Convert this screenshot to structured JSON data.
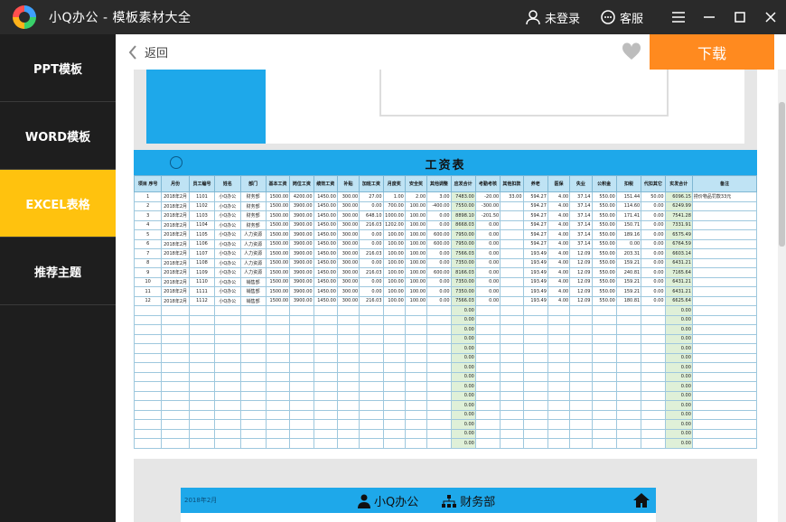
{
  "app": {
    "title": "小Q办公 - 模板素材大全"
  },
  "titlebar": {
    "login_label": "未登录",
    "service_label": "客服"
  },
  "sidebar": {
    "items": [
      {
        "label": "PPT模板",
        "active": false
      },
      {
        "label": "WORD模板",
        "active": false
      },
      {
        "label": "EXCEL表格",
        "active": true
      },
      {
        "label": "推荐主题",
        "active": false
      }
    ]
  },
  "toolbar": {
    "back_label": "返回",
    "download_label": "下载"
  },
  "sheet": {
    "title": "工资表",
    "headers": [
      "项目\n序号",
      "月份",
      "员工编号",
      "姓名",
      "部门",
      "基本工资",
      "岗位工资",
      "绩效工资",
      "补贴",
      "加班工资",
      "月度奖",
      "安全奖",
      "其他调整",
      "应发合计",
      "考勤考核",
      "其他扣款",
      "养老",
      "医保",
      "失业",
      "公积金",
      "扣税",
      "代扣其它",
      "实发合计",
      "备注"
    ],
    "rows": [
      [
        "1",
        "2018年2月",
        "1101",
        "小Q办公",
        "财务部",
        "1500.00",
        "4200.00",
        "1450.00",
        "300.00",
        "27.00",
        "1.00",
        "2.00",
        "3.00",
        "7483.00",
        "-20.00",
        "33.00",
        "594.27",
        "4.00",
        "37.14",
        "550.00",
        "151.44",
        "50.00",
        "6096.15",
        "捞价物品罚款33元"
      ],
      [
        "2",
        "2018年2月",
        "1102",
        "小Q办公",
        "财务部",
        "1500.00",
        "3900.00",
        "1450.00",
        "300.00",
        "0.00",
        "700.00",
        "100.00",
        "-400.00",
        "7550.00",
        "-300.00",
        "",
        "594.27",
        "4.00",
        "37.14",
        "550.00",
        "114.60",
        "0.00",
        "6249.99",
        ""
      ],
      [
        "3",
        "2018年2月",
        "1103",
        "小Q办公",
        "财务部",
        "1500.00",
        "3900.00",
        "1450.00",
        "300.00",
        "648.10",
        "1000.00",
        "100.00",
        "0.00",
        "8898.10",
        "-201.50",
        "",
        "594.27",
        "4.00",
        "37.14",
        "550.00",
        "171.41",
        "0.00",
        "7541.28",
        ""
      ],
      [
        "4",
        "2018年2月",
        "1104",
        "小Q办公",
        "财务部",
        "1500.00",
        "3900.00",
        "1450.00",
        "300.00",
        "216.03",
        "1202.00",
        "100.00",
        "0.00",
        "8668.03",
        "0.00",
        "",
        "594.27",
        "4.00",
        "37.14",
        "550.00",
        "150.71",
        "0.00",
        "7331.91",
        ""
      ],
      [
        "5",
        "2018年2月",
        "1105",
        "小Q办公",
        "人力资源",
        "1500.00",
        "3900.00",
        "1450.00",
        "300.00",
        "0.00",
        "100.00",
        "100.00",
        "600.00",
        "7950.00",
        "0.00",
        "",
        "594.27",
        "4.00",
        "37.14",
        "550.00",
        "189.16",
        "0.00",
        "6575.49",
        ""
      ],
      [
        "6",
        "2018年2月",
        "1106",
        "小Q办公",
        "人力资源",
        "1500.00",
        "3900.00",
        "1450.00",
        "300.00",
        "0.00",
        "100.00",
        "100.00",
        "600.00",
        "7950.00",
        "0.00",
        "",
        "594.27",
        "4.00",
        "37.14",
        "550.00",
        "0.00",
        "0.00",
        "6764.59",
        ""
      ],
      [
        "7",
        "2018年2月",
        "1107",
        "小Q办公",
        "人力资源",
        "1500.00",
        "3900.00",
        "1450.00",
        "300.00",
        "216.03",
        "100.00",
        "100.00",
        "0.00",
        "7566.03",
        "0.00",
        "",
        "193.49",
        "4.00",
        "12.09",
        "550.00",
        "203.31",
        "0.00",
        "6603.14",
        ""
      ],
      [
        "8",
        "2018年2月",
        "1108",
        "小Q办公",
        "人力资源",
        "1500.00",
        "3900.00",
        "1450.00",
        "300.00",
        "0.00",
        "100.00",
        "100.00",
        "0.00",
        "7350.00",
        "0.00",
        "",
        "193.49",
        "4.00",
        "12.09",
        "550.00",
        "159.21",
        "0.00",
        "6431.21",
        ""
      ],
      [
        "9",
        "2018年2月",
        "1109",
        "小Q办公",
        "人力资源",
        "1500.00",
        "3900.00",
        "1450.00",
        "300.00",
        "216.03",
        "100.00",
        "100.00",
        "600.00",
        "8166.03",
        "0.00",
        "",
        "193.49",
        "4.00",
        "12.09",
        "550.00",
        "240.81",
        "0.00",
        "7165.64",
        ""
      ],
      [
        "10",
        "2018年2月",
        "1110",
        "小Q办公",
        "销售部",
        "1500.00",
        "3900.00",
        "1450.00",
        "300.00",
        "0.00",
        "100.00",
        "100.00",
        "0.00",
        "7350.00",
        "0.00",
        "",
        "193.49",
        "4.00",
        "12.09",
        "550.00",
        "159.21",
        "0.00",
        "6431.21",
        ""
      ],
      [
        "11",
        "2018年2月",
        "1111",
        "小Q办公",
        "销售部",
        "1500.00",
        "3900.00",
        "1450.00",
        "300.00",
        "0.00",
        "100.00",
        "100.00",
        "0.00",
        "7350.00",
        "0.00",
        "",
        "193.49",
        "4.00",
        "12.09",
        "550.00",
        "159.21",
        "0.00",
        "6431.21",
        ""
      ],
      [
        "12",
        "2018年2月",
        "1112",
        "小Q办公",
        "销售部",
        "1500.00",
        "3900.00",
        "1450.00",
        "300.00",
        "216.03",
        "100.00",
        "100.00",
        "0.00",
        "7566.03",
        "0.00",
        "",
        "193.49",
        "4.00",
        "12.09",
        "550.00",
        "180.81",
        "0.00",
        "6625.64",
        ""
      ]
    ],
    "zero_value": "0.00"
  },
  "bottom": {
    "date": "2018年2月",
    "brand": "小Q办公",
    "dept": "财务部"
  },
  "colors": {
    "accent_blue": "#1ea8ea",
    "active_yellow": "#ffc20e",
    "download_orange": "#ff8a1f",
    "titlebar": "#2a2a2a"
  },
  "icons": [
    "user-icon",
    "chat-icon",
    "menu-icon",
    "minimize-icon",
    "maximize-icon",
    "close-icon",
    "back-chevron-icon",
    "heart-icon",
    "home-icon",
    "org-icon",
    "person-icon"
  ]
}
